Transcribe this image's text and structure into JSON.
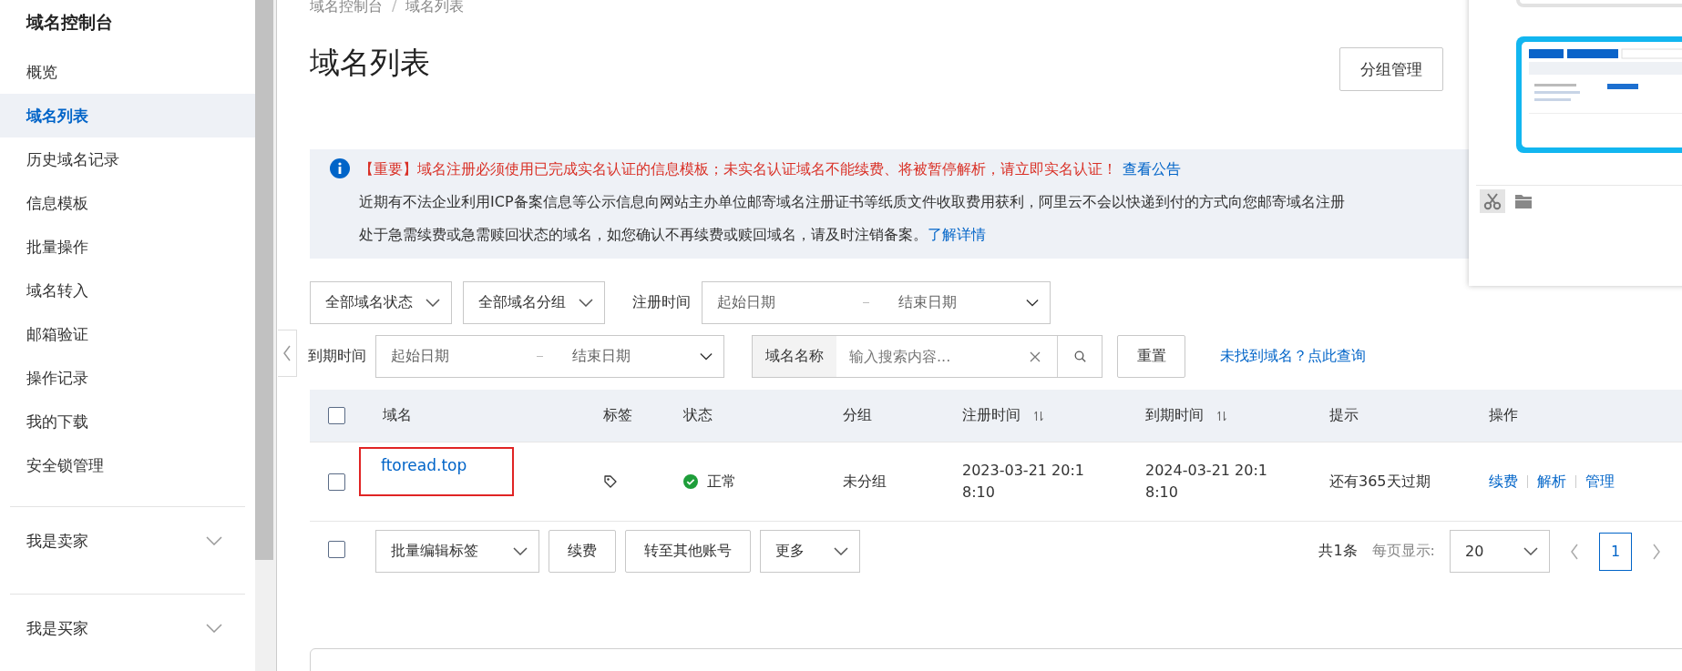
{
  "sidebar": {
    "title": "域名控制台",
    "items": [
      {
        "label": "概览",
        "selected": false
      },
      {
        "label": "域名列表",
        "selected": true
      },
      {
        "label": "历史域名记录",
        "selected": false
      },
      {
        "label": "信息模板",
        "selected": false
      },
      {
        "label": "批量操作",
        "selected": false
      },
      {
        "label": "域名转入",
        "selected": false
      },
      {
        "label": "邮箱验证",
        "selected": false
      },
      {
        "label": "操作记录",
        "selected": false
      },
      {
        "label": "我的下载",
        "selected": false
      },
      {
        "label": "安全锁管理",
        "selected": false
      }
    ],
    "groups": [
      {
        "label": "我是卖家",
        "expanded": false
      },
      {
        "label": "我是买家",
        "expanded": false
      }
    ]
  },
  "breadcrumb": {
    "items": [
      "域名控制台",
      "域名列表"
    ],
    "separator": "/"
  },
  "page_title": "域名列表",
  "header_buttons": [
    "分组管理"
  ],
  "notice": {
    "important": "【重要】域名注册必须使用已完成实名认证的信息模板；未实名认证域名不能续费、将被暂停解析，请立即实名认证！",
    "important_link": "查看公告",
    "line2": "近期有不法企业利用ICP备案信息等公示信息向网站主办单位邮寄域名注册证书等纸质文件收取费用获利，阿里云不会以快递到付的方式向您邮寄域名注册",
    "line3": "处于急需续费或急需赎回状态的域名，如您确认不再续费或赎回域名，请及时注销备案。",
    "line3_link": "了解详情"
  },
  "filters": {
    "status": "全部域名状态",
    "group": "全部域名分组",
    "reg_label": "注册时间",
    "reg_start": "起始日期",
    "reg_end": "结束日期",
    "exp_label": "到期时间",
    "exp_start": "起始日期",
    "exp_end": "结束日期",
    "search_label": "域名名称",
    "search_placeholder": "输入搜索内容...",
    "reset": "重置",
    "not_found_link": "未找到域名？点此查询"
  },
  "table": {
    "select_all_checked": false,
    "columns": [
      {
        "label": "域名",
        "kind": "plain"
      },
      {
        "label": "标签",
        "kind": "plain"
      },
      {
        "label": "状态",
        "kind": "plain"
      },
      {
        "label": "分组",
        "kind": "plain"
      },
      {
        "label": "注册时间",
        "kind": "sortable"
      },
      {
        "label": "到期时间",
        "kind": "sortable"
      },
      {
        "label": "提示",
        "kind": "plain"
      },
      {
        "label": "操作",
        "kind": "plain"
      }
    ],
    "rows": [
      {
        "checked": false,
        "highlighted": true,
        "domain": "ftoread.top",
        "status": "正常",
        "group": "未分组",
        "registered": [
          "2023-03-21 20:1",
          "8:10"
        ],
        "expires": [
          "2024-03-21 20:1",
          "8:10"
        ],
        "hint": "还有365天过期",
        "actions": [
          "续费",
          "解析",
          "管理"
        ]
      }
    ]
  },
  "footer": {
    "checked": false,
    "batch_tags": "批量编辑标签",
    "renew": "续费",
    "transfer": "转至其他账号",
    "more": "更多",
    "total": "共1条",
    "per_page_label": "每页显示:",
    "per_page": "20",
    "pages": [
      {
        "label": "1",
        "selected": true
      }
    ]
  },
  "overlay": {
    "tools": [
      {
        "kind": "scissors",
        "selected": true
      },
      {
        "kind": "folder",
        "selected": false
      }
    ]
  }
}
